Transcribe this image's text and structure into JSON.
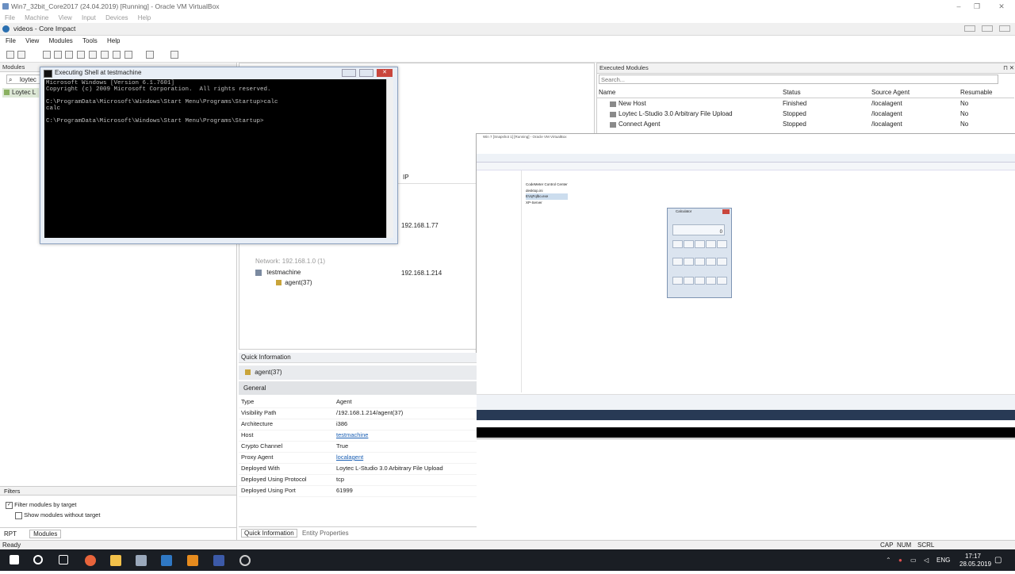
{
  "host": {
    "title": "Win7_32bit_Core2017 (24.04.2019) [Running] - Oracle VM VirtualBox",
    "menu": [
      "File",
      "Machine",
      "View",
      "Input",
      "Devices",
      "Help"
    ]
  },
  "app": {
    "title": "videos - Core Impact",
    "menu": [
      "File",
      "View",
      "Modules",
      "Tools",
      "Help"
    ],
    "modules_panel": {
      "header": "Modules",
      "search_value": "loytec",
      "tree_item": "Loytec L"
    },
    "filters": {
      "header": "Filters",
      "opt1": "Filter modules by target",
      "opt2": "Show modules without target"
    },
    "bottom_tabs": [
      "RPT",
      "Modules"
    ]
  },
  "shell": {
    "title": "Executing Shell at testmachine",
    "lines": "Microsoft Windows [Version 6.1.7601]\nCopyright (c) 2009 Microsoft Corporation.  All rights reserved.\n\nC:\\ProgramData\\Microsoft\\Windows\\Start Menu\\Programs\\Startup>calc\ncalc\n\nC:\\ProgramData\\Microsoft\\Windows\\Start Menu\\Programs\\Startup>"
  },
  "executed": {
    "header": "Executed Modules",
    "search_placeholder": "Search...",
    "columns": [
      "Name",
      "Status",
      "Source Agent",
      "Resumable"
    ],
    "rows": [
      {
        "name": "New Host",
        "status": "Finished",
        "agent": "/localagent",
        "res": "No"
      },
      {
        "name": "Loytec L-Studio 3.0 Arbitrary File Upload",
        "status": "Stopped",
        "agent": "/localagent",
        "res": "No"
      },
      {
        "name": "Connect Agent",
        "status": "Stopped",
        "agent": "/localagent",
        "res": "No"
      }
    ]
  },
  "network": {
    "col_ip": "IP",
    "ip1": "192.168.1.77",
    "network_label": "Network: 192.168.1.0 (1)",
    "host": "testmachine",
    "host_ip": "192.168.1.214",
    "agent": "agent(37)"
  },
  "quick": {
    "header": "Quick Information",
    "entity": "agent(37)",
    "section": "General",
    "rows": [
      {
        "k": "Type",
        "v": "Agent"
      },
      {
        "k": "Visibility Path",
        "v": "/192.168.1.214/agent(37)"
      },
      {
        "k": "Architecture",
        "v": "i386"
      },
      {
        "k": "Host",
        "v": "testmachine"
      },
      {
        "k": "Crypto Channel",
        "v": "True"
      },
      {
        "k": "Proxy Agent",
        "v": "localagent"
      },
      {
        "k": "Deployed With",
        "v": "Loytec L-Studio 3.0 Arbitrary File Upload"
      },
      {
        "k": "Deployed Using Protocol",
        "v": "tcp"
      },
      {
        "k": "Deployed Using Port",
        "v": "61999"
      }
    ],
    "tabs": [
      "Quick Information",
      "Entity Properties"
    ]
  },
  "vm": {
    "title": "Win 7 [Snapshot 1] [Running] - Oracle VM VirtualBox",
    "calc_title": "Calculator",
    "calc_value": "0",
    "files": [
      "CodeMeter Control Center",
      "desktop.ini",
      "EVqFqlbo.exe",
      "XP-Server"
    ]
  },
  "status": {
    "left": "Ready",
    "caps": "CAP",
    "num": "NUM",
    "scrl": "SCRL"
  },
  "taskbar": {
    "lang": "ENG",
    "time": "17:17",
    "date": "28.05.2019"
  }
}
